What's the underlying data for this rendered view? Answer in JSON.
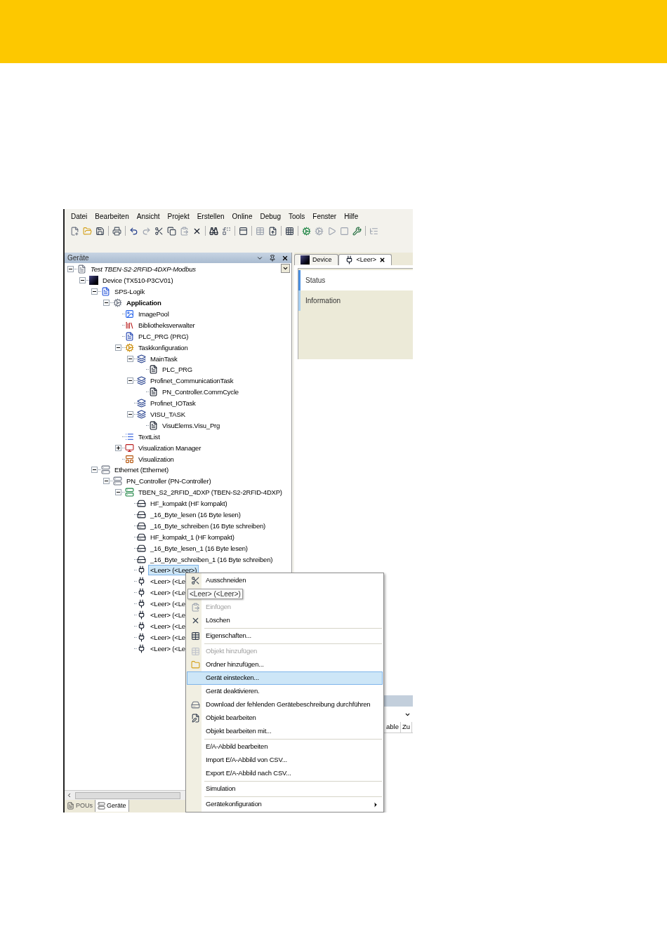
{
  "menu_bar": [
    "Datei",
    "Bearbeiten",
    "Ansicht",
    "Projekt",
    "Erstellen",
    "Online",
    "Debug",
    "Tools",
    "Fenster",
    "Hilfe"
  ],
  "devices_panel": {
    "title": "Geräte",
    "tree": [
      {
        "label": "Test TBEN-S2-2RFID-4DXP-Modbus",
        "kind": "project",
        "selected": false,
        "expanded": true,
        "children": [
          {
            "label": "Device (TX510-P3CV01)",
            "kind": "device",
            "selected": false,
            "expanded": true,
            "children": [
              {
                "label": "SPS-Logik",
                "kind": "plc-logic",
                "selected": false,
                "expanded": true,
                "children": [
                  {
                    "label": "Application",
                    "kind": "application",
                    "selected": false,
                    "expanded": true,
                    "children": [
                      {
                        "label": "ImagePool",
                        "kind": "image-pool",
                        "selected": false
                      },
                      {
                        "label": "Bibliotheksverwalter",
                        "kind": "library",
                        "selected": false
                      },
                      {
                        "label": "PLC_PRG (PRG)",
                        "kind": "pou",
                        "selected": false
                      },
                      {
                        "label": "Taskkonfiguration",
                        "kind": "task-config",
                        "selected": false,
                        "expanded": true,
                        "children": [
                          {
                            "label": "MainTask",
                            "kind": "task",
                            "selected": false,
                            "expanded": true,
                            "children": [
                              {
                                "label": "PLC_PRG",
                                "kind": "call",
                                "selected": false
                              }
                            ]
                          },
                          {
                            "label": "Profinet_CommunicationTask",
                            "kind": "task",
                            "selected": false,
                            "expanded": true,
                            "children": [
                              {
                                "label": "PN_Controller.CommCycle",
                                "kind": "call",
                                "selected": false
                              }
                            ]
                          },
                          {
                            "label": "Profinet_IOTask",
                            "kind": "task",
                            "selected": false
                          },
                          {
                            "label": "VISU_TASK",
                            "kind": "task",
                            "selected": false,
                            "expanded": true,
                            "children": [
                              {
                                "label": "VisuElems.Visu_Prg",
                                "kind": "call",
                                "selected": false
                              }
                            ]
                          }
                        ]
                      },
                      {
                        "label": "TextList",
                        "kind": "textlist",
                        "selected": false
                      },
                      {
                        "label": "Visualization Manager",
                        "kind": "visu-manager",
                        "selected": false,
                        "expanded": false
                      },
                      {
                        "label": "Visualization",
                        "kind": "visu",
                        "selected": false
                      }
                    ]
                  }
                ]
              },
              {
                "label": "Ethernet (Ethernet)",
                "kind": "ethernet",
                "selected": false,
                "expanded": true,
                "children": [
                  {
                    "label": "PN_Controller (PN-Controller)",
                    "kind": "pn-controller",
                    "selected": false,
                    "expanded": true,
                    "children": [
                      {
                        "label": "TBEN_S2_2RFID_4DXP (TBEN-S2-2RFID-4DXP)",
                        "kind": "io-device",
                        "selected": false,
                        "expanded": true,
                        "children": [
                          {
                            "label": "HF_kompakt (HF kompakt)",
                            "kind": "module",
                            "selected": false
                          },
                          {
                            "label": "_16_Byte_lesen (16 Byte lesen)",
                            "kind": "module",
                            "selected": false
                          },
                          {
                            "label": "_16_Byte_schreiben (16 Byte schreiben)",
                            "kind": "module",
                            "selected": false
                          },
                          {
                            "label": "HF_kompakt_1 (HF kompakt)",
                            "kind": "module",
                            "selected": false
                          },
                          {
                            "label": "_16_Byte_lesen_1 (16 Byte lesen)",
                            "kind": "module",
                            "selected": false
                          },
                          {
                            "label": "_16_Byte_schreiben_1 (16 Byte schreiben)",
                            "kind": "module",
                            "selected": false
                          },
                          {
                            "label": "<Leer> (<Leer>)",
                            "kind": "slot",
                            "selected": true
                          },
                          {
                            "label": "<Leer> (<Le",
                            "kind": "slot",
                            "selected": false
                          },
                          {
                            "label": "<Leer> (<Le",
                            "kind": "slot",
                            "selected": false
                          },
                          {
                            "label": "<Leer> (<Le",
                            "kind": "slot",
                            "selected": false
                          },
                          {
                            "label": "<Leer> (<Le",
                            "kind": "slot",
                            "selected": false
                          },
                          {
                            "label": "<Leer> (<Le",
                            "kind": "slot",
                            "selected": false
                          },
                          {
                            "label": "<Leer> (<Le",
                            "kind": "slot",
                            "selected": false
                          },
                          {
                            "label": "<Leer> (<Le",
                            "kind": "slot",
                            "selected": false
                          }
                        ]
                      }
                    ]
                  }
                ]
              }
            ]
          }
        ]
      }
    ],
    "bottom_tabs": [
      {
        "label": "POUs",
        "selected": false
      },
      {
        "label": "Geräte",
        "selected": true
      }
    ]
  },
  "editor": {
    "tabs": [
      {
        "label": "Device",
        "kind": "device",
        "selected": false
      },
      {
        "label": "<Leer>",
        "kind": "slot",
        "selected": true
      }
    ],
    "sections": [
      {
        "label": "Status",
        "selected": true
      },
      {
        "label": "Information",
        "selected": false
      }
    ]
  },
  "lower_panel": {
    "columns": [
      "able",
      "Zu"
    ]
  },
  "context_menu": [
    {
      "kind": "item",
      "label": "Ausschneiden",
      "disabled": false,
      "selected": false,
      "submenu": false
    },
    {
      "kind": "tooltip",
      "label": "<Leer> (<Leer>)"
    },
    {
      "kind": "item",
      "label": "Einfügen",
      "disabled": true,
      "selected": false,
      "submenu": false
    },
    {
      "kind": "item",
      "label": "Löschen",
      "disabled": false,
      "selected": false,
      "submenu": false
    },
    {
      "kind": "separator"
    },
    {
      "kind": "item",
      "label": "Eigenschaften...",
      "disabled": false,
      "selected": false,
      "submenu": false
    },
    {
      "kind": "separator"
    },
    {
      "kind": "item",
      "label": "Objekt hinzufügen",
      "disabled": true,
      "selected": false,
      "submenu": false
    },
    {
      "kind": "item",
      "label": "Ordner hinzufügen...",
      "disabled": false,
      "selected": false,
      "submenu": false
    },
    {
      "kind": "item",
      "label": "Gerät einstecken...",
      "disabled": false,
      "selected": true,
      "submenu": false
    },
    {
      "kind": "item",
      "label": "Gerät deaktivieren.",
      "disabled": false,
      "selected": false,
      "submenu": false
    },
    {
      "kind": "item",
      "label": "Download der fehlenden Gerätebeschreibung durchführen",
      "disabled": false,
      "selected": false,
      "submenu": false
    },
    {
      "kind": "item",
      "label": "Objekt bearbeiten",
      "disabled": false,
      "selected": false,
      "submenu": false
    },
    {
      "kind": "item",
      "label": "Objekt bearbeiten mit...",
      "disabled": false,
      "selected": false,
      "submenu": false
    },
    {
      "kind": "separator"
    },
    {
      "kind": "item",
      "label": "E/A-Abbild bearbeiten",
      "disabled": false,
      "selected": false,
      "submenu": false
    },
    {
      "kind": "item",
      "label": "Import E/A-Abbild von CSV...",
      "disabled": false,
      "selected": false,
      "submenu": false
    },
    {
      "kind": "item",
      "label": "Export E/A-Abbild nach CSV...",
      "disabled": false,
      "selected": false,
      "submenu": false
    },
    {
      "kind": "separator"
    },
    {
      "kind": "item",
      "label": "Simulation",
      "disabled": false,
      "selected": false,
      "submenu": false
    },
    {
      "kind": "separator"
    },
    {
      "kind": "item",
      "label": "Gerätekonfiguration",
      "disabled": false,
      "selected": false,
      "submenu": true
    }
  ]
}
